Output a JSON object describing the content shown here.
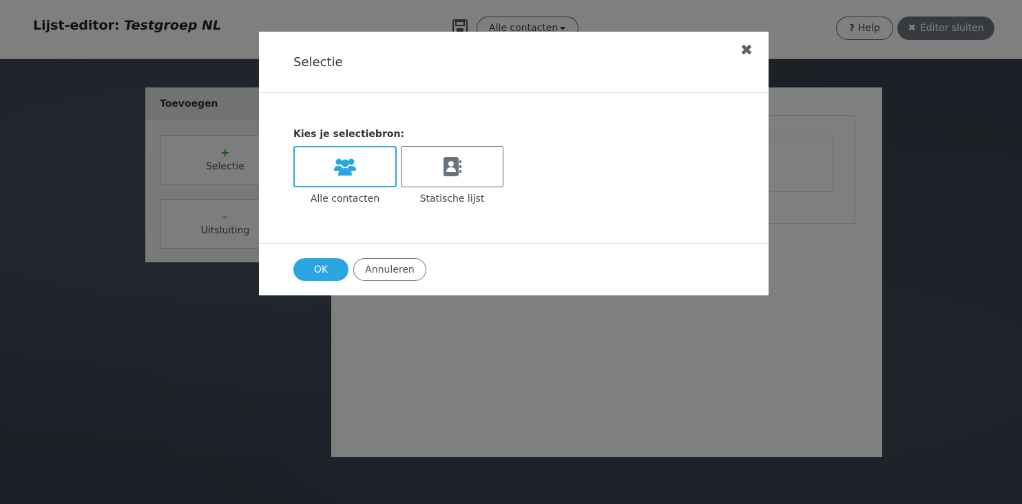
{
  "header": {
    "title_prefix": "Lijst-editor:",
    "title_group": "Testgroep NL",
    "contacts_dropdown": "Alle contacten",
    "help_label": "Help",
    "close_editor_label": "Editor sluiten"
  },
  "sidebar": {
    "heading": "Toevoegen",
    "items": [
      {
        "symbol": "+",
        "label": "Selectie"
      },
      {
        "symbol": "–",
        "label": "Uitsluiting"
      }
    ]
  },
  "modal": {
    "title": "Selectie",
    "source_label": "Kies je selectiebron:",
    "options": [
      {
        "label": "Alle contacten",
        "icon": "users-icon",
        "selected": true
      },
      {
        "label": "Statische lijst",
        "icon": "address-book-icon",
        "selected": false
      }
    ],
    "ok_label": "OK",
    "cancel_label": "Annuleren"
  },
  "colors": {
    "accent": "#2aa7e0",
    "plus": "#2aa832",
    "minus": "#e0a020"
  }
}
